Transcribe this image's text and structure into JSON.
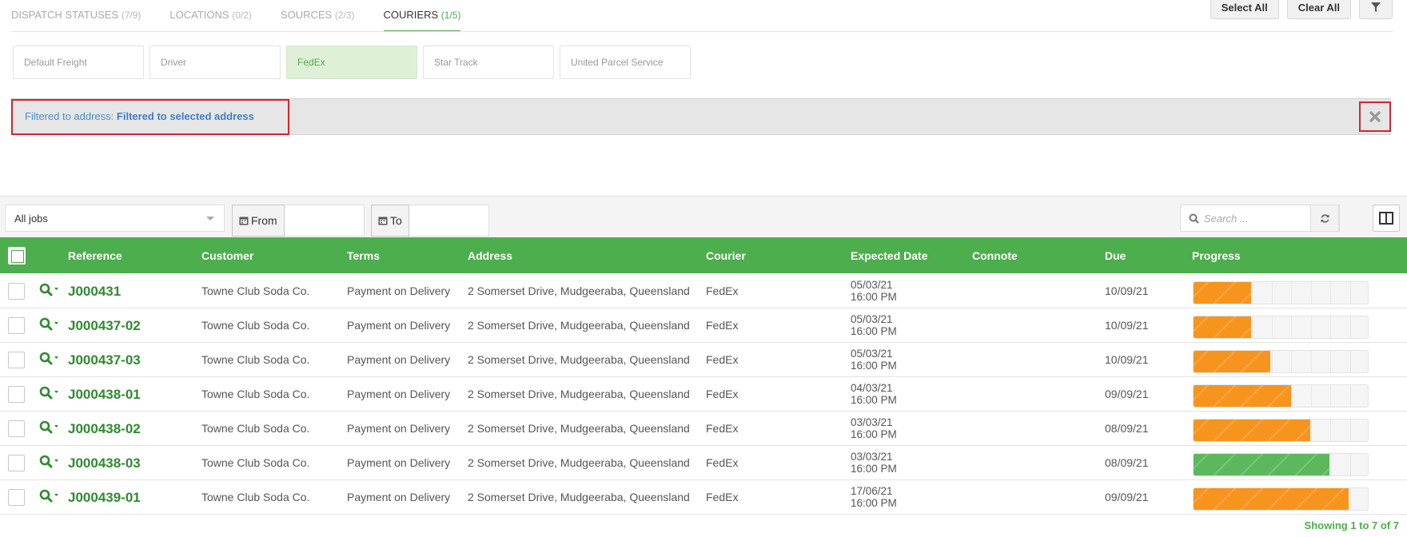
{
  "tabs": [
    {
      "label": "DISPATCH STATUSES",
      "count": "(7/9)"
    },
    {
      "label": "LOCATIONS",
      "count": "(0/2)"
    },
    {
      "label": "SOURCES",
      "count": "(2/3)"
    },
    {
      "label": "COURIERS",
      "count": "(1/5)",
      "active": true
    }
  ],
  "actions": {
    "select_all": "Select All",
    "clear_all": "Clear All",
    "filter_icon": "funnel-icon"
  },
  "couriers": [
    {
      "label": "Default Freight",
      "active": false
    },
    {
      "label": "Driver",
      "active": false
    },
    {
      "label": "FedEx",
      "active": true
    },
    {
      "label": "Star Track",
      "active": false
    },
    {
      "label": "United Parcel Service",
      "active": false
    }
  ],
  "filter": {
    "prefix": "Filtered to address:",
    "value": "Filtered to selected address",
    "close_icon": "close-x-icon"
  },
  "toolbar": {
    "jobs_select": "All jobs",
    "from_label": "From",
    "to_label": "To",
    "search_placeholder": "Search ...",
    "icons": {
      "calendar": "calendar-icon",
      "search": "search-icon",
      "refresh": "refresh-icon",
      "columns": "columns-icon"
    }
  },
  "columns": [
    "Reference",
    "Customer",
    "Terms",
    "Address",
    "Courier",
    "Expected Date",
    "Connote",
    "Due",
    "Progress"
  ],
  "rows": [
    {
      "reference": "J000431",
      "customer": "Towne Club Soda Co.",
      "terms": "Payment on Delivery",
      "address": "2 Somerset Drive, Mudgeeraba, Queensland",
      "courier": "FedEx",
      "expected_date": "05/03/21",
      "expected_time": "16:00 PM",
      "connote": "",
      "due": "10/09/21",
      "progress": 0.33,
      "progress_color": "#f7941d"
    },
    {
      "reference": "J000437-02",
      "customer": "Towne Club Soda Co.",
      "terms": "Payment on Delivery",
      "address": "2 Somerset Drive, Mudgeeraba, Queensland",
      "courier": "FedEx",
      "expected_date": "05/03/21",
      "expected_time": "16:00 PM",
      "connote": "",
      "due": "10/09/21",
      "progress": 0.33,
      "progress_color": "#f7941d"
    },
    {
      "reference": "J000437-03",
      "customer": "Towne Club Soda Co.",
      "terms": "Payment on Delivery",
      "address": "2 Somerset Drive, Mudgeeraba, Queensland",
      "courier": "FedEx",
      "expected_date": "05/03/21",
      "expected_time": "16:00 PM",
      "connote": "",
      "due": "10/09/21",
      "progress": 0.44,
      "progress_color": "#f7941d"
    },
    {
      "reference": "J000438-01",
      "customer": "Towne Club Soda Co.",
      "terms": "Payment on Delivery",
      "address": "2 Somerset Drive, Mudgeeraba, Queensland",
      "courier": "FedEx",
      "expected_date": "04/03/21",
      "expected_time": "16:00 PM",
      "connote": "",
      "due": "09/09/21",
      "progress": 0.56,
      "progress_color": "#f7941d"
    },
    {
      "reference": "J000438-02",
      "customer": "Towne Club Soda Co.",
      "terms": "Payment on Delivery",
      "address": "2 Somerset Drive, Mudgeeraba, Queensland",
      "courier": "FedEx",
      "expected_date": "03/03/21",
      "expected_time": "16:00 PM",
      "connote": "",
      "due": "08/09/21",
      "progress": 0.67,
      "progress_color": "#f7941d"
    },
    {
      "reference": "J000438-03",
      "customer": "Towne Club Soda Co.",
      "terms": "Payment on Delivery",
      "address": "2 Somerset Drive, Mudgeeraba, Queensland",
      "courier": "FedEx",
      "expected_date": "03/03/21",
      "expected_time": "16:00 PM",
      "connote": "",
      "due": "08/09/21",
      "progress": 0.78,
      "progress_color": "#5cb85c"
    },
    {
      "reference": "J000439-01",
      "customer": "Towne Club Soda Co.",
      "terms": "Payment on Delivery",
      "address": "2 Somerset Drive, Mudgeeraba, Queensland",
      "courier": "FedEx",
      "expected_date": "17/06/21",
      "expected_time": "16:00 PM",
      "connote": "",
      "due": "09/09/21",
      "progress": 0.89,
      "progress_color": "#f7941d"
    }
  ],
  "footer": "Showing 1 to 7 of 7"
}
